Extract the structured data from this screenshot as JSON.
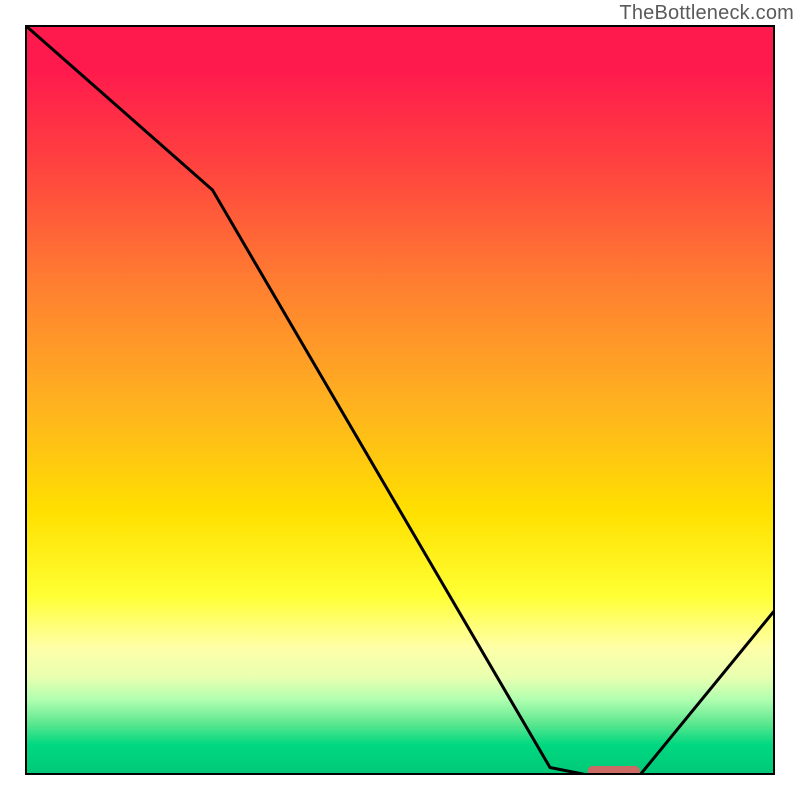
{
  "watermark": "TheBottleneck.com",
  "chart_data": {
    "type": "line",
    "title": "",
    "xlabel": "",
    "ylabel": "",
    "xlim": [
      0,
      100
    ],
    "ylim": [
      0,
      100
    ],
    "grid": false,
    "legend": false,
    "series": [
      {
        "name": "curve",
        "x": [
          0,
          25,
          70,
          75,
          82,
          100
        ],
        "values": [
          100,
          78,
          1,
          0,
          0,
          22
        ]
      }
    ],
    "optimum_marker": {
      "x_start": 75,
      "x_end": 82,
      "y": 0,
      "color": "#cc6b66",
      "thickness_px": 10
    },
    "background_gradient": {
      "top": "#ff1a4d",
      "mid_upper": "#ff8030",
      "mid": "#ffe000",
      "mid_lower": "#ffffa8",
      "bottom": "#00c878"
    }
  }
}
